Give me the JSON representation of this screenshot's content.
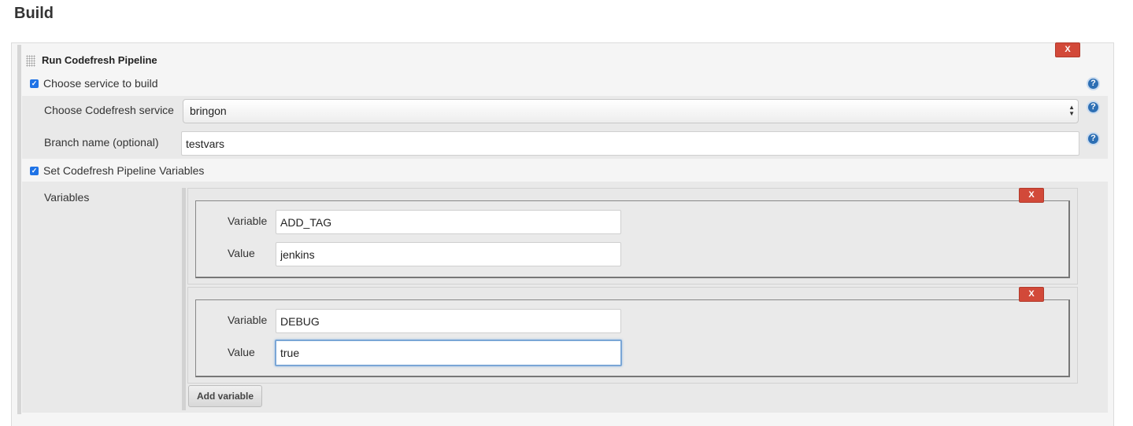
{
  "section": {
    "title": "Build"
  },
  "builder": {
    "title": "Run Codefresh Pipeline",
    "delete_label": "X",
    "choose_service": {
      "checkbox_label": "Choose service to build",
      "checked": true,
      "service_label": "Choose Codefresh service",
      "service_value": "bringon",
      "branch_label": "Branch name (optional)",
      "branch_value": "testvars"
    },
    "pipeline_vars": {
      "checkbox_label": "Set Codefresh Pipeline Variables",
      "checked": true,
      "variables_label": "Variables",
      "entries": [
        {
          "variable_label": "Variable",
          "variable_value": "ADD_TAG",
          "value_label": "Value",
          "value_value": "jenkins",
          "delete_label": "X"
        },
        {
          "variable_label": "Variable",
          "variable_value": "DEBUG",
          "value_label": "Value",
          "value_value": "true",
          "delete_label": "X"
        }
      ],
      "add_label": "Add variable"
    }
  },
  "help_icon": "help-icon",
  "colors": {
    "delete": "#d24939",
    "checkbox": "#1f73e6",
    "focus": "#7aa6d6",
    "help": "#2d6fb4"
  }
}
